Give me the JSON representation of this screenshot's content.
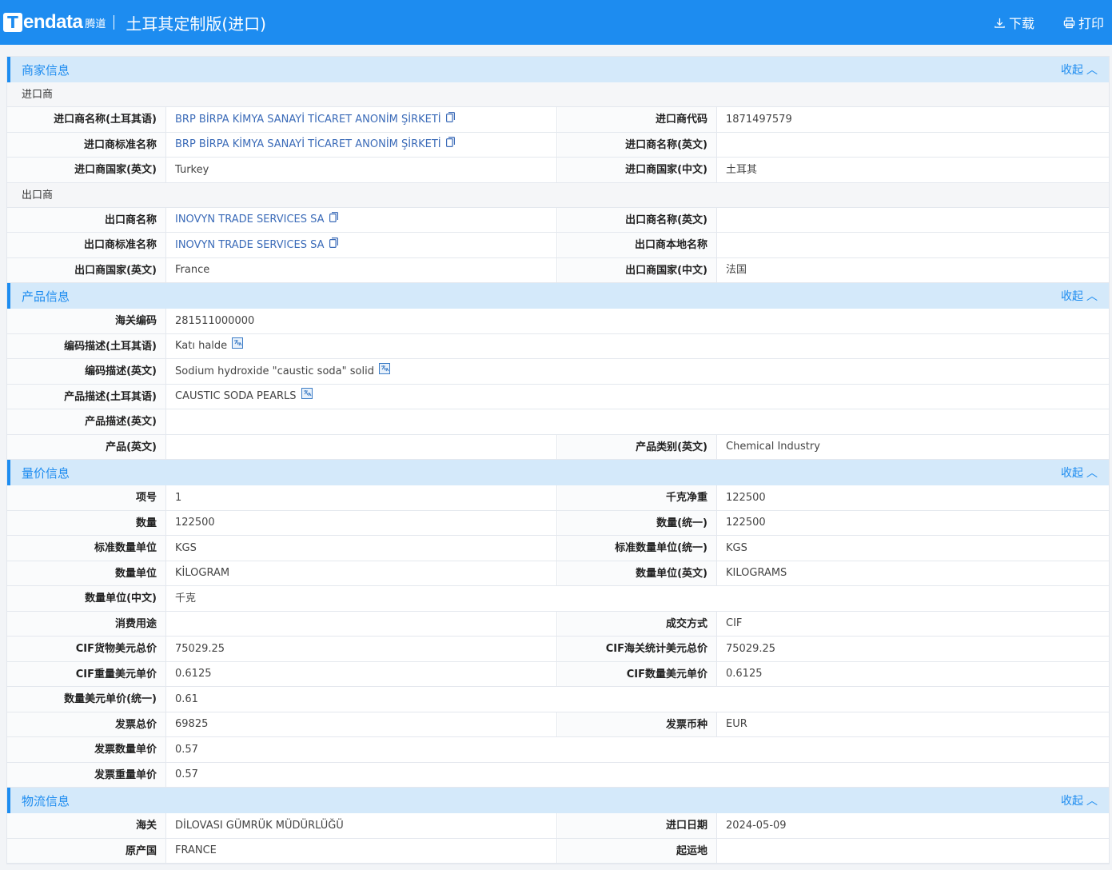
{
  "header": {
    "logo_word": "endata",
    "logo_letter": "T",
    "logo_cn": "腾道",
    "title": "土耳其定制版(进口)",
    "download": "下载",
    "print": "打印"
  },
  "collapse_label": "收起",
  "sections": {
    "merchant": {
      "title": "商家信息",
      "importer_head": "进口商",
      "exporter_head": "出口商",
      "importer_rows": [
        {
          "l1": "进口商名称(土耳其语)",
          "v1": "BRP BİRPA KİMYA SANAYİ TİCARET ANONİM ŞİRKETİ",
          "l2": "进口商代码",
          "v2": "1871497579"
        },
        {
          "l1": "进口商标准名称",
          "v1": "BRP BİRPA KİMYA SANAYİ TİCARET ANONİM ŞİRKETİ",
          "l2": "进口商名称(英文)",
          "v2": ""
        },
        {
          "l1": "进口商国家(英文)",
          "v1": "Turkey",
          "l2": "进口商国家(中文)",
          "v2": "土耳其"
        }
      ],
      "exporter_rows": [
        {
          "l1": "出口商名称",
          "v1": "INOVYN TRADE SERVICES SA",
          "l2": "出口商名称(英文)",
          "v2": ""
        },
        {
          "l1": "出口商标准名称",
          "v1": "INOVYN TRADE SERVICES SA",
          "l2": "出口商本地名称",
          "v2": ""
        },
        {
          "l1": "出口商国家(英文)",
          "v1": "France",
          "l2": "出口商国家(中文)",
          "v2": "法国"
        }
      ]
    },
    "product": {
      "title": "产品信息",
      "hs_label": "海关编码",
      "hs_value": "281511000000",
      "desc_tr_label": "编码描述(土耳其语)",
      "desc_tr_value": "Katı halde",
      "desc_en_label": "编码描述(英文)",
      "desc_en_value": "Sodium hydroxide \"caustic soda\" solid",
      "pdesc_tr_label": "产品描述(土耳其语)",
      "pdesc_tr_value": "CAUSTIC SODA PEARLS",
      "pdesc_en_label": "产品描述(英文)",
      "pdesc_en_value": "",
      "prod_en_label": "产品(英文)",
      "prod_en_value": "",
      "cat_label": "产品类别(英文)",
      "cat_value": "Chemical Industry"
    },
    "price": {
      "title": "量价信息",
      "r1": {
        "l1": "项号",
        "v1": "1",
        "l2": "千克净重",
        "v2": "122500"
      },
      "r2": {
        "l1": "数量",
        "v1": "122500",
        "l2": "数量(统一)",
        "v2": "122500"
      },
      "r3": {
        "l1": "标准数量单位",
        "v1": "KGS",
        "l2": "标准数量单位(统一)",
        "v2": "KGS"
      },
      "r4": {
        "l1": "数量单位",
        "v1": "KİLOGRAM",
        "l2": "数量单位(英文)",
        "v2": "KILOGRAMS"
      },
      "r5": {
        "l1": "数量单位(中文)",
        "v1": "千克"
      },
      "r6": {
        "l1": "消费用途",
        "v1": "",
        "l2": "成交方式",
        "v2": "CIF"
      },
      "r7": {
        "l1": "CIF货物美元总价",
        "v1": "75029.25",
        "l2": "CIF海关统计美元总价",
        "v2": "75029.25"
      },
      "r8": {
        "l1": "CIF重量美元单价",
        "v1": "0.6125",
        "l2": "CIF数量美元单价",
        "v2": "0.6125"
      },
      "r9": {
        "l1": "数量美元单价(统一)",
        "v1": "0.61"
      },
      "r10": {
        "l1": "发票总价",
        "v1": "69825",
        "l2": "发票币种",
        "v2": "EUR"
      },
      "r11": {
        "l1": "发票数量单价",
        "v1": "0.57"
      },
      "r12": {
        "l1": "发票重量单价",
        "v1": "0.57"
      }
    },
    "logistics": {
      "title": "物流信息",
      "r1": {
        "l1": "海关",
        "v1": "DİLOVASI GÜMRÜK MÜDÜRLÜĞÜ",
        "l2": "进口日期",
        "v2": "2024-05-09"
      },
      "r2": {
        "l1": "原产国",
        "v1": "FRANCE",
        "l2": "起运地",
        "v2": ""
      }
    }
  }
}
